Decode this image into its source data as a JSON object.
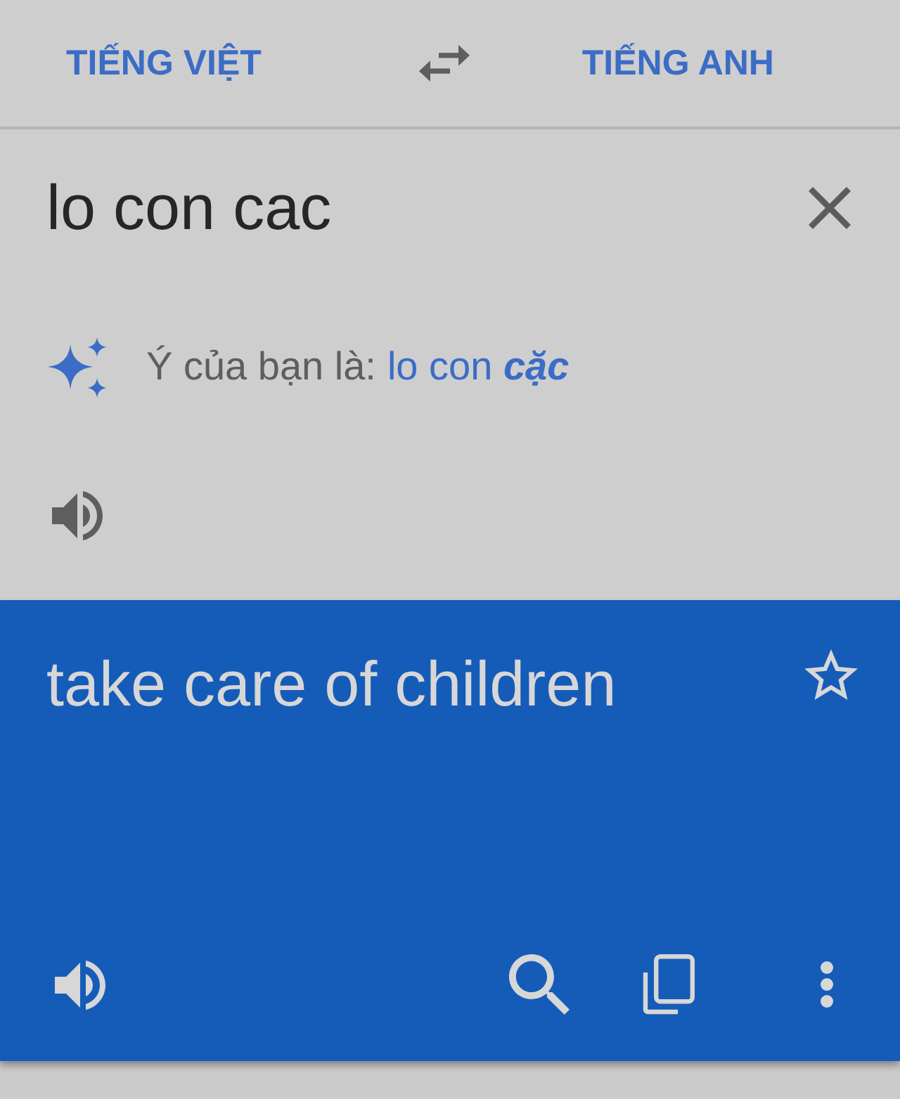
{
  "languages": {
    "source": {
      "label": "TIẾNG VIỆT"
    },
    "target": {
      "label": "TIẾNG ANH"
    }
  },
  "input": {
    "value": "lo con cac"
  },
  "suggestion": {
    "prefix": "Ý của bạn là:",
    "text": "lo con **cặc**"
  },
  "translation": {
    "text": "take care of children",
    "starred": false
  }
}
